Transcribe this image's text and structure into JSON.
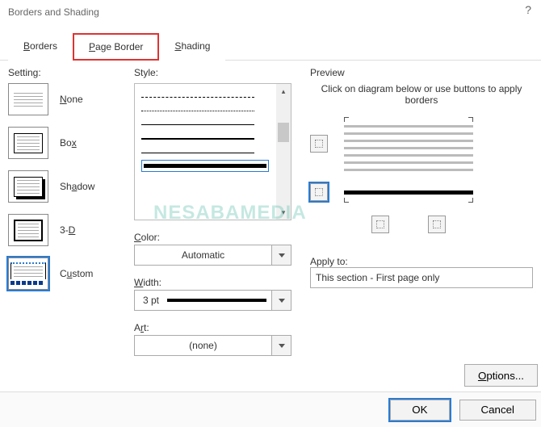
{
  "title": "Borders and Shading",
  "help": "?",
  "tabs": {
    "borders": "Borders",
    "page_border": "Page Border",
    "shading": "Shading"
  },
  "setting": {
    "label": "Setting:",
    "none": {
      "label": "None",
      "key": "N"
    },
    "box": {
      "label": "Box",
      "key": "x"
    },
    "shadow": {
      "label": "Shadow",
      "key": "A"
    },
    "threed": {
      "label": "3-D",
      "key": "D"
    },
    "custom": {
      "label": "Custom",
      "key": "U"
    }
  },
  "style": {
    "label": "Style:",
    "color_label": "Color:",
    "color_value": "Automatic",
    "width_label": "Width:",
    "width_value": "3 pt",
    "art_label": "Art:",
    "art_value": "(none)"
  },
  "preview": {
    "label": "Preview",
    "help": "Click on diagram below or use buttons to apply borders",
    "apply_label": "Apply to:",
    "apply_value": "This section - First page only",
    "options": "Options..."
  },
  "footer": {
    "ok": "OK",
    "cancel": "Cancel"
  },
  "watermark": "NESABAMEDIA"
}
